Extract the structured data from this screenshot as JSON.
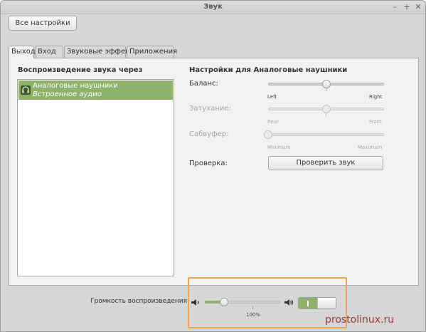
{
  "window": {
    "title": "Звук",
    "minimize": "–",
    "maximize": "+",
    "close": "✕"
  },
  "toolbar": {
    "all_settings": "Все настройки"
  },
  "tabs": [
    {
      "label": "Выход",
      "active": true
    },
    {
      "label": "Вход",
      "active": false
    },
    {
      "label": "Звуковые эффекты",
      "active": false
    },
    {
      "label": "Приложения",
      "active": false
    }
  ],
  "output": {
    "heading": "Воспроизведение звука через",
    "device": {
      "name": "Аналоговые наушники",
      "sub": "Встроенное аудио",
      "icon": "headphones-icon"
    }
  },
  "settings": {
    "heading": "Настройки для Аналоговые наушники",
    "balance": {
      "label": "Баланс:",
      "left": "Left",
      "right": "Right",
      "value": 0.5
    },
    "fade": {
      "label": "Затухание:",
      "left": "Rear",
      "right": "Front",
      "value": 0.5
    },
    "subwoofer": {
      "label": "Сабвуфер:",
      "left": "Minimum",
      "right": "Maximum",
      "value": 0
    },
    "test": {
      "label": "Проверка:",
      "button": "Проверить звук"
    }
  },
  "volume": {
    "label": "Громкость воспроизведения:",
    "value": 0.25,
    "percent_label": "100%",
    "muted": false,
    "icon_low": "speaker-low-icon",
    "icon_high": "speaker-high-icon"
  },
  "watermark": "prostolinux.ru",
  "colors": {
    "accent": "#8fb26a",
    "highlight": "#f0a54c",
    "watermark": "#9d3a3a"
  }
}
